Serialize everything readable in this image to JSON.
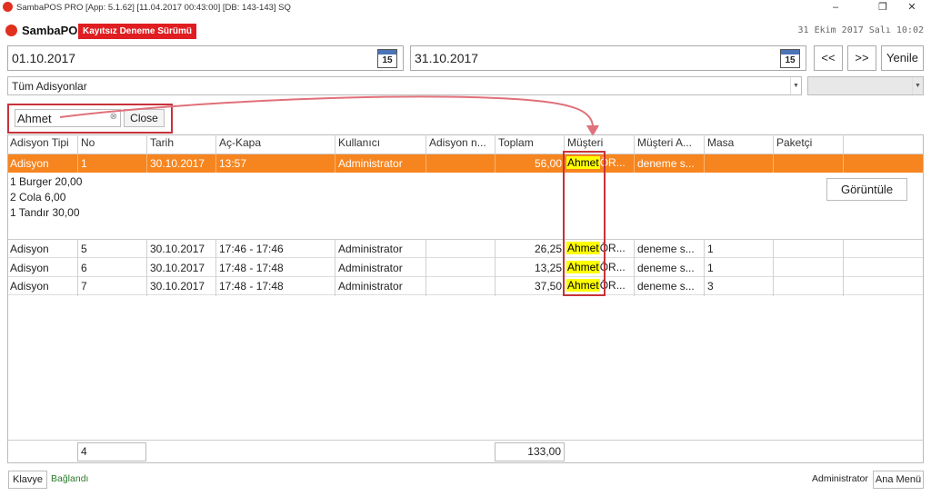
{
  "window": {
    "title": "SambaPOS PRO [App: 5.1.62] [11.04.2017 00:43:00] [DB: 143-143] SQ"
  },
  "header": {
    "logo": "SambaPOS",
    "trial_badge": "Kayıtsız Deneme Sürümü",
    "datetime": "31 Ekim 2017 Salı 10:02"
  },
  "filters": {
    "start_date": "01.10.2017",
    "end_date": "31.10.2017",
    "calendar_day": "15",
    "prev_label": "<<",
    "next_label": ">>",
    "refresh_label": "Yenile",
    "ticket_filter": "Tüm Adisyonlar",
    "search_value": "Ahmet",
    "close_label": "Close"
  },
  "columns": [
    "Adisyon Tipi",
    "No",
    "Tarih",
    "Aç-Kapa",
    "Kullanıcı",
    "Adisyon n...",
    "Toplam",
    "Müşteri",
    "Müşteri A...",
    "Masa",
    "Paketçi"
  ],
  "rows": [
    {
      "type": "Adisyon",
      "no": "1",
      "date": "30.10.2017",
      "time": "13:57",
      "user": "Administrator",
      "note": "",
      "total": "56,00",
      "customer": "Ahmet",
      "customer_rest": "ÖR...",
      "customer_a": "deneme s...",
      "table": "",
      "courier": ""
    },
    {
      "type": "Adisyon",
      "no": "5",
      "date": "30.10.2017",
      "time": "17:46 - 17:46",
      "user": "Administrator",
      "note": "",
      "total": "26,25",
      "customer": "Ahmet",
      "customer_rest": "ÖR...",
      "customer_a": "deneme s...",
      "table": "1",
      "courier": ""
    },
    {
      "type": "Adisyon",
      "no": "6",
      "date": "30.10.2017",
      "time": "17:48 - 17:48",
      "user": "Administrator",
      "note": "",
      "total": "13,25",
      "customer": "Ahmet",
      "customer_rest": "ÖR...",
      "customer_a": "deneme s...",
      "table": "1",
      "courier": ""
    },
    {
      "type": "Adisyon",
      "no": "7",
      "date": "30.10.2017",
      "time": "17:48 - 17:48",
      "user": "Administrator",
      "note": "",
      "total": "37,50",
      "customer": "Ahmet",
      "customer_rest": "ÖR...",
      "customer_a": "deneme s...",
      "table": "3",
      "courier": ""
    }
  ],
  "details": {
    "lines": [
      "1 Burger 20,00",
      "2 Cola 6,00",
      "1 Tandır 30,00"
    ],
    "view_label": "Görüntüle"
  },
  "footer": {
    "count": "4",
    "total": "133,00"
  },
  "statusbar": {
    "keyboard_label": "Klavye",
    "connection": "Bağlandı",
    "user": "Administrator",
    "main_menu_label": "Ana Menü"
  },
  "colors": {
    "selected_row": "#f7851f",
    "highlight": "#ffff00",
    "annotation": "#c8323a",
    "trial": "#e01e22"
  }
}
